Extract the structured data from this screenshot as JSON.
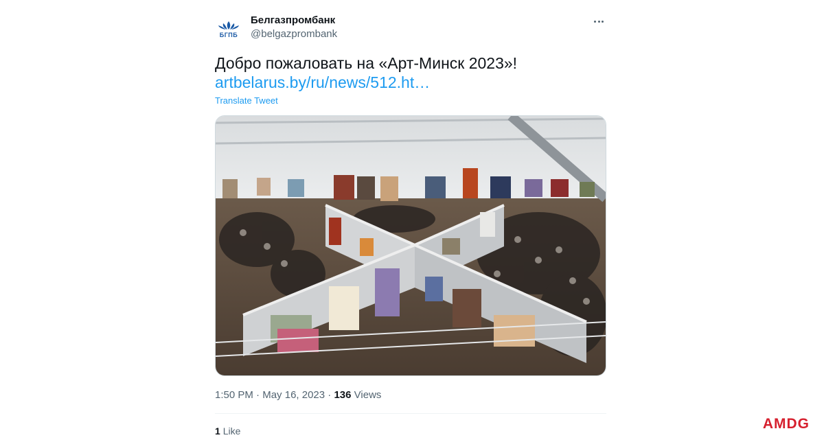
{
  "tweet": {
    "display_name": "Белгазпромбанк",
    "handle": "@belgazprombank",
    "avatar_text": "БГПБ",
    "text": "Добро пожаловать на «Арт-Минск 2023»!",
    "link": "artbelarus.by/ru/news/512.ht…",
    "translate_label": "Translate Tweet",
    "media_icon": "photo",
    "time": "1:50 PM",
    "separator": "·",
    "date": "May 16, 2023",
    "views_count": "136",
    "views_label": "Views",
    "likes_count": "1",
    "likes_label": "Like"
  },
  "watermark": "AMDG",
  "colors": {
    "link": "#1d9bf0",
    "secondary_text": "#536471",
    "brand_red": "#d6202e",
    "bank_blue": "#1b5aa6"
  }
}
